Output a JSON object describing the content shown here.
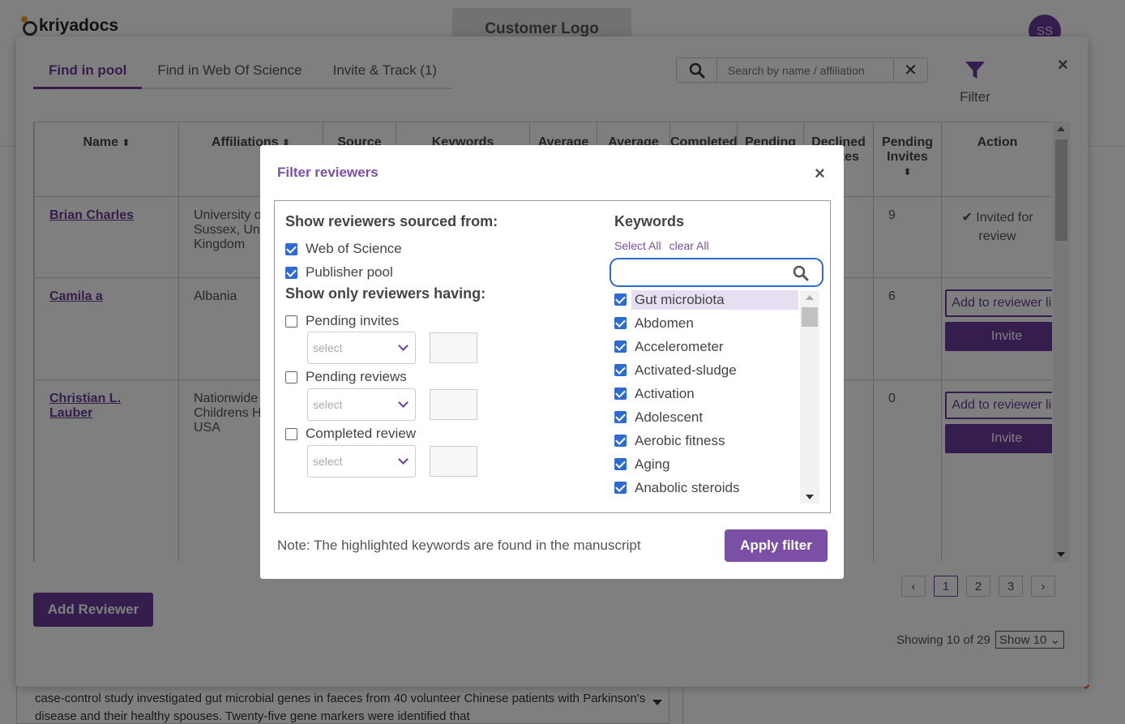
{
  "app": {
    "logo_text": "kriyadocs",
    "customer_logo": "Customer Logo",
    "user_initials": "SS",
    "background_text": "case-control study investigated gut microbial genes in faeces from 40 volunteer Chinese patients with Parkinson's disease and their healthy spouses. Twenty-five gene markers were identified that"
  },
  "modal": {
    "tabs": [
      "Find in pool",
      "Find in Web Of Science",
      "Invite & Track (1)"
    ],
    "active_tab": 0,
    "search_placeholder": "Search by name / affiliation",
    "filter_label": "Filter",
    "close": "×"
  },
  "table": {
    "columns": [
      "Name",
      "Affiliations",
      "Source",
      "Keywords",
      "Average",
      "Average",
      "Completed",
      "Pending",
      "Declined invites",
      "Pending Invites",
      "Action"
    ],
    "rows": [
      {
        "name": "Brian Charles",
        "affiliation": "University of Sussex, United Kingdom",
        "pending_invites": "9",
        "action": "Invited for review"
      },
      {
        "name": "Camila a",
        "affiliation": "Albania",
        "pending_invites": "6",
        "action": "Add to reviewer list",
        "invite": "Invite"
      },
      {
        "name": "Christian L. Lauber",
        "affiliation": "Nationwide Childrens Hospital, USA",
        "pending_invites": "0",
        "action": "Add to reviewer list",
        "invite": "Invite"
      }
    ]
  },
  "footer": {
    "add_reviewer": "Add Reviewer",
    "pages": [
      "1",
      "2",
      "3"
    ],
    "current_page": "1",
    "showing": "Showing 10 of 29",
    "show_select": "Show 10"
  },
  "filter_dialog": {
    "title": "Filter reviewers",
    "close": "×",
    "sourced_title": "Show reviewers sourced from:",
    "sources": [
      {
        "label": "Web of Science",
        "checked": true
      },
      {
        "label": "Publisher pool",
        "checked": true
      }
    ],
    "having_title": "Show only reviewers having:",
    "having": [
      {
        "label": "Pending invites",
        "checked": false,
        "select": "select"
      },
      {
        "label": "Pending reviews",
        "checked": false,
        "select": "select"
      },
      {
        "label": "Completed review",
        "checked": false,
        "select": "select"
      }
    ],
    "keywords_title": "Keywords",
    "select_all": "Select All",
    "clear_all": "clear All",
    "keywords": [
      {
        "label": "Gut microbiota",
        "checked": true,
        "highlight": true
      },
      {
        "label": "Abdomen",
        "checked": true,
        "highlight": false
      },
      {
        "label": "Accelerometer",
        "checked": true,
        "highlight": false
      },
      {
        "label": "Activated-sludge",
        "checked": true,
        "highlight": false
      },
      {
        "label": "Activation",
        "checked": true,
        "highlight": false
      },
      {
        "label": "Adolescent",
        "checked": true,
        "highlight": false
      },
      {
        "label": "Aerobic fitness",
        "checked": true,
        "highlight": false
      },
      {
        "label": "Aging",
        "checked": true,
        "highlight": false
      },
      {
        "label": "Anabolic steroids",
        "checked": true,
        "highlight": false
      }
    ],
    "note": "Note: The highlighted keywords are found in the manuscript",
    "apply": "Apply filter"
  },
  "colors": {
    "brand": "#6a3d9a",
    "accent_blue": "#2e6ad3",
    "highlight": "#e6dff2"
  }
}
